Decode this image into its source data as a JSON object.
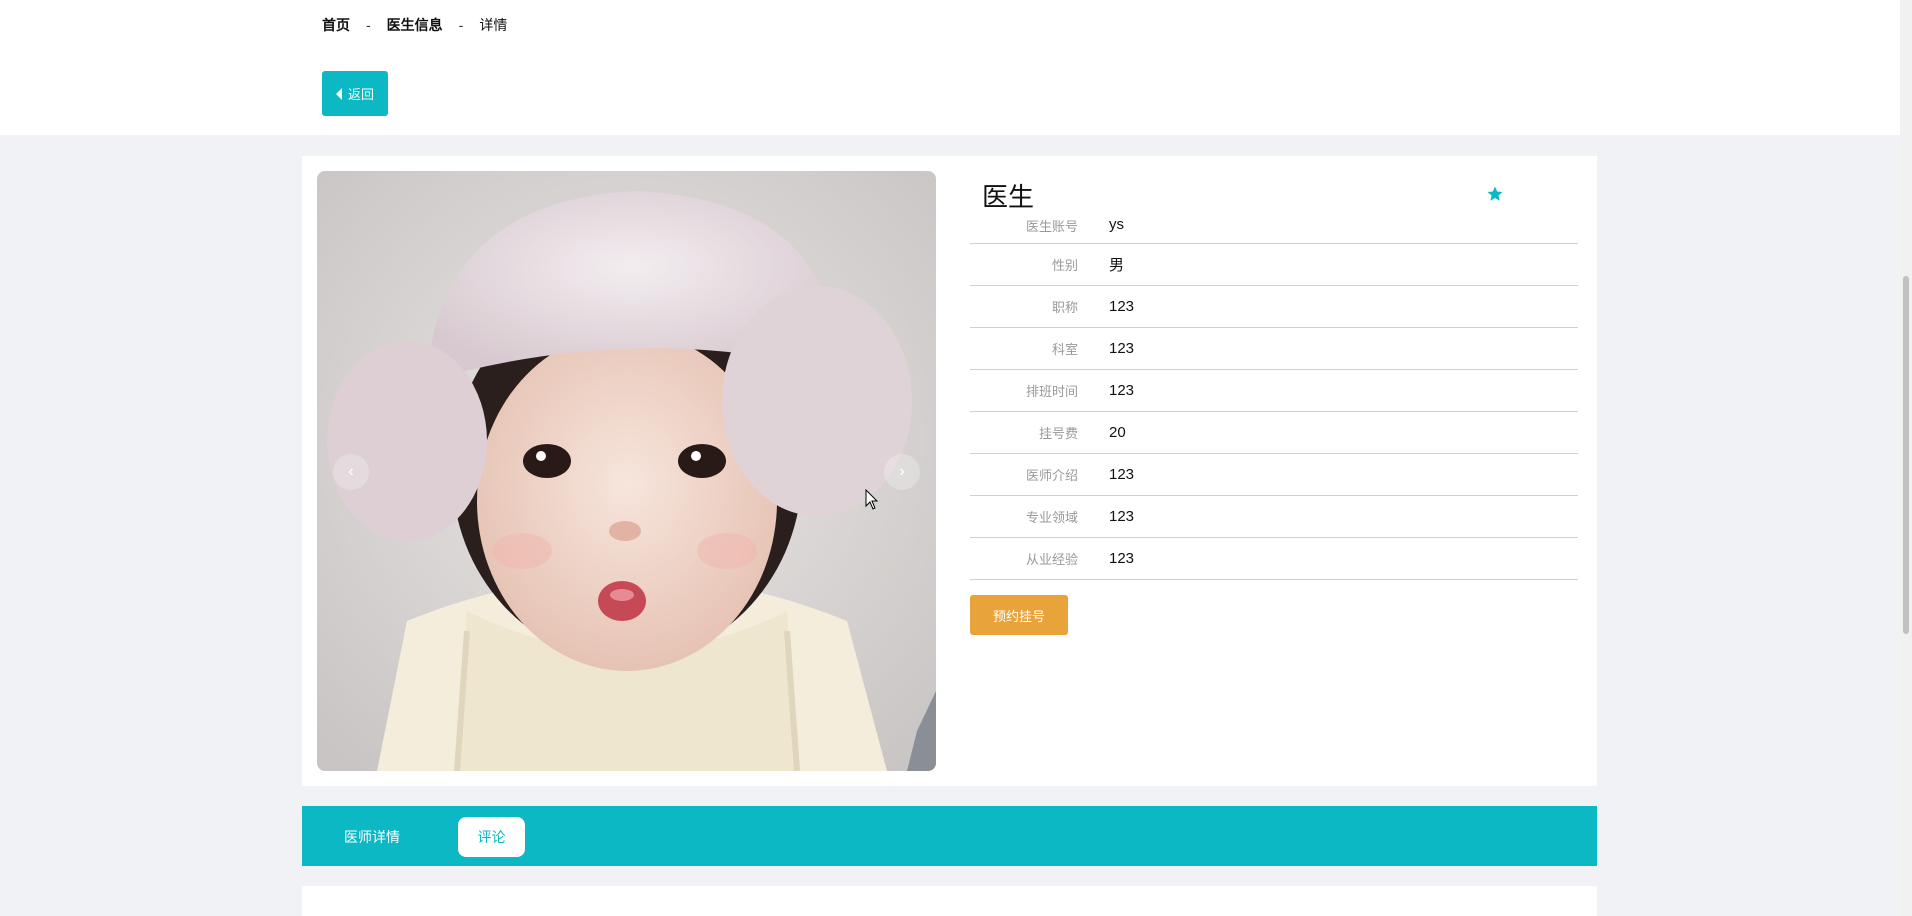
{
  "breadcrumb": {
    "home": "首页",
    "section": "医生信息",
    "current": "详情",
    "separator": "-"
  },
  "back_button": {
    "label": "返回",
    "icon": "caret-left-icon"
  },
  "doctor": {
    "title": "医生",
    "favorite_icon": "star-icon",
    "fields": [
      {
        "label": "医生账号",
        "value": "ys"
      },
      {
        "label": "性别",
        "value": "男"
      },
      {
        "label": "职称",
        "value": "123"
      },
      {
        "label": "科室",
        "value": "123"
      },
      {
        "label": "排班时间",
        "value": "123"
      },
      {
        "label": "挂号费",
        "value": "20"
      },
      {
        "label": "医师介绍",
        "value": "123"
      },
      {
        "label": "专业领域",
        "value": "123"
      },
      {
        "label": "从业经验",
        "value": "123"
      }
    ],
    "book_button": "预约挂号"
  },
  "carousel": {
    "prev": "‹",
    "next": "›"
  },
  "tabs": [
    {
      "label": "医师详情",
      "active": false
    },
    {
      "label": "评论",
      "active": true
    }
  ],
  "colors": {
    "accent": "#0bb8c4",
    "book": "#e8a43a",
    "page_bg": "#f0f2f5"
  }
}
